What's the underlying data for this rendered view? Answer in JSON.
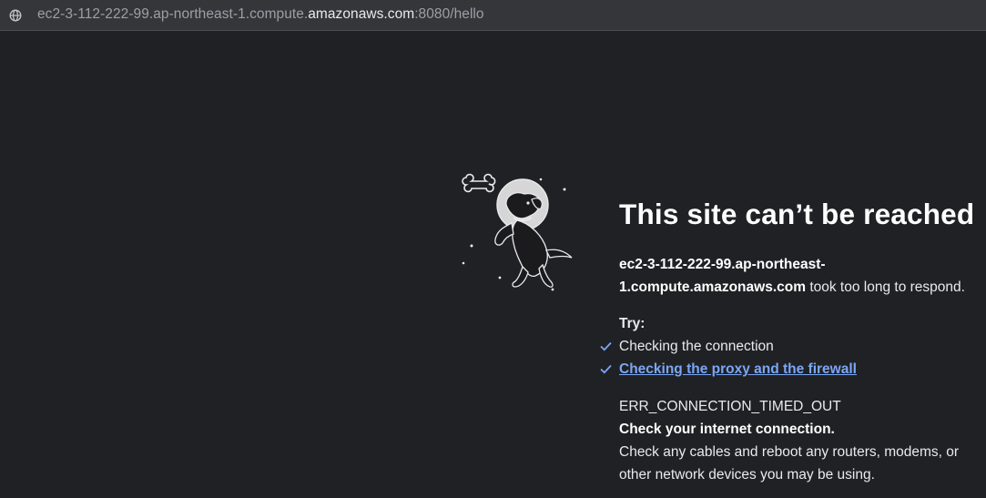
{
  "browser": {
    "url_prefix": "ec2-3-112-222-99.ap-northeast-1.compute.",
    "url_domain": "amazonaws.com",
    "url_suffix": ":8080/hello"
  },
  "error_page": {
    "title": "This site can’t be reached",
    "host": "ec2-3-112-222-99.ap-northeast-1.compute.amazonaws.com",
    "message_suffix": " took too long to respond.",
    "try_label": "Try:",
    "suggestions": [
      {
        "label": "Checking the connection",
        "is_link": false
      },
      {
        "label": "Checking the proxy and the firewall",
        "is_link": true
      }
    ],
    "error_code": "ERR_CONNECTION_TIMED_OUT",
    "check_heading": "Check your internet connection.",
    "check_details": "Check any cables and reboot any routers, modems, or other network devices you may be using."
  },
  "icons": {
    "address": "globe-icon",
    "illustration": "space-dog-illustration",
    "bullets": "checkmark-icon"
  },
  "colors": {
    "background": "#202124",
    "link": "#7aa7f7",
    "text": "#e8eaed"
  }
}
